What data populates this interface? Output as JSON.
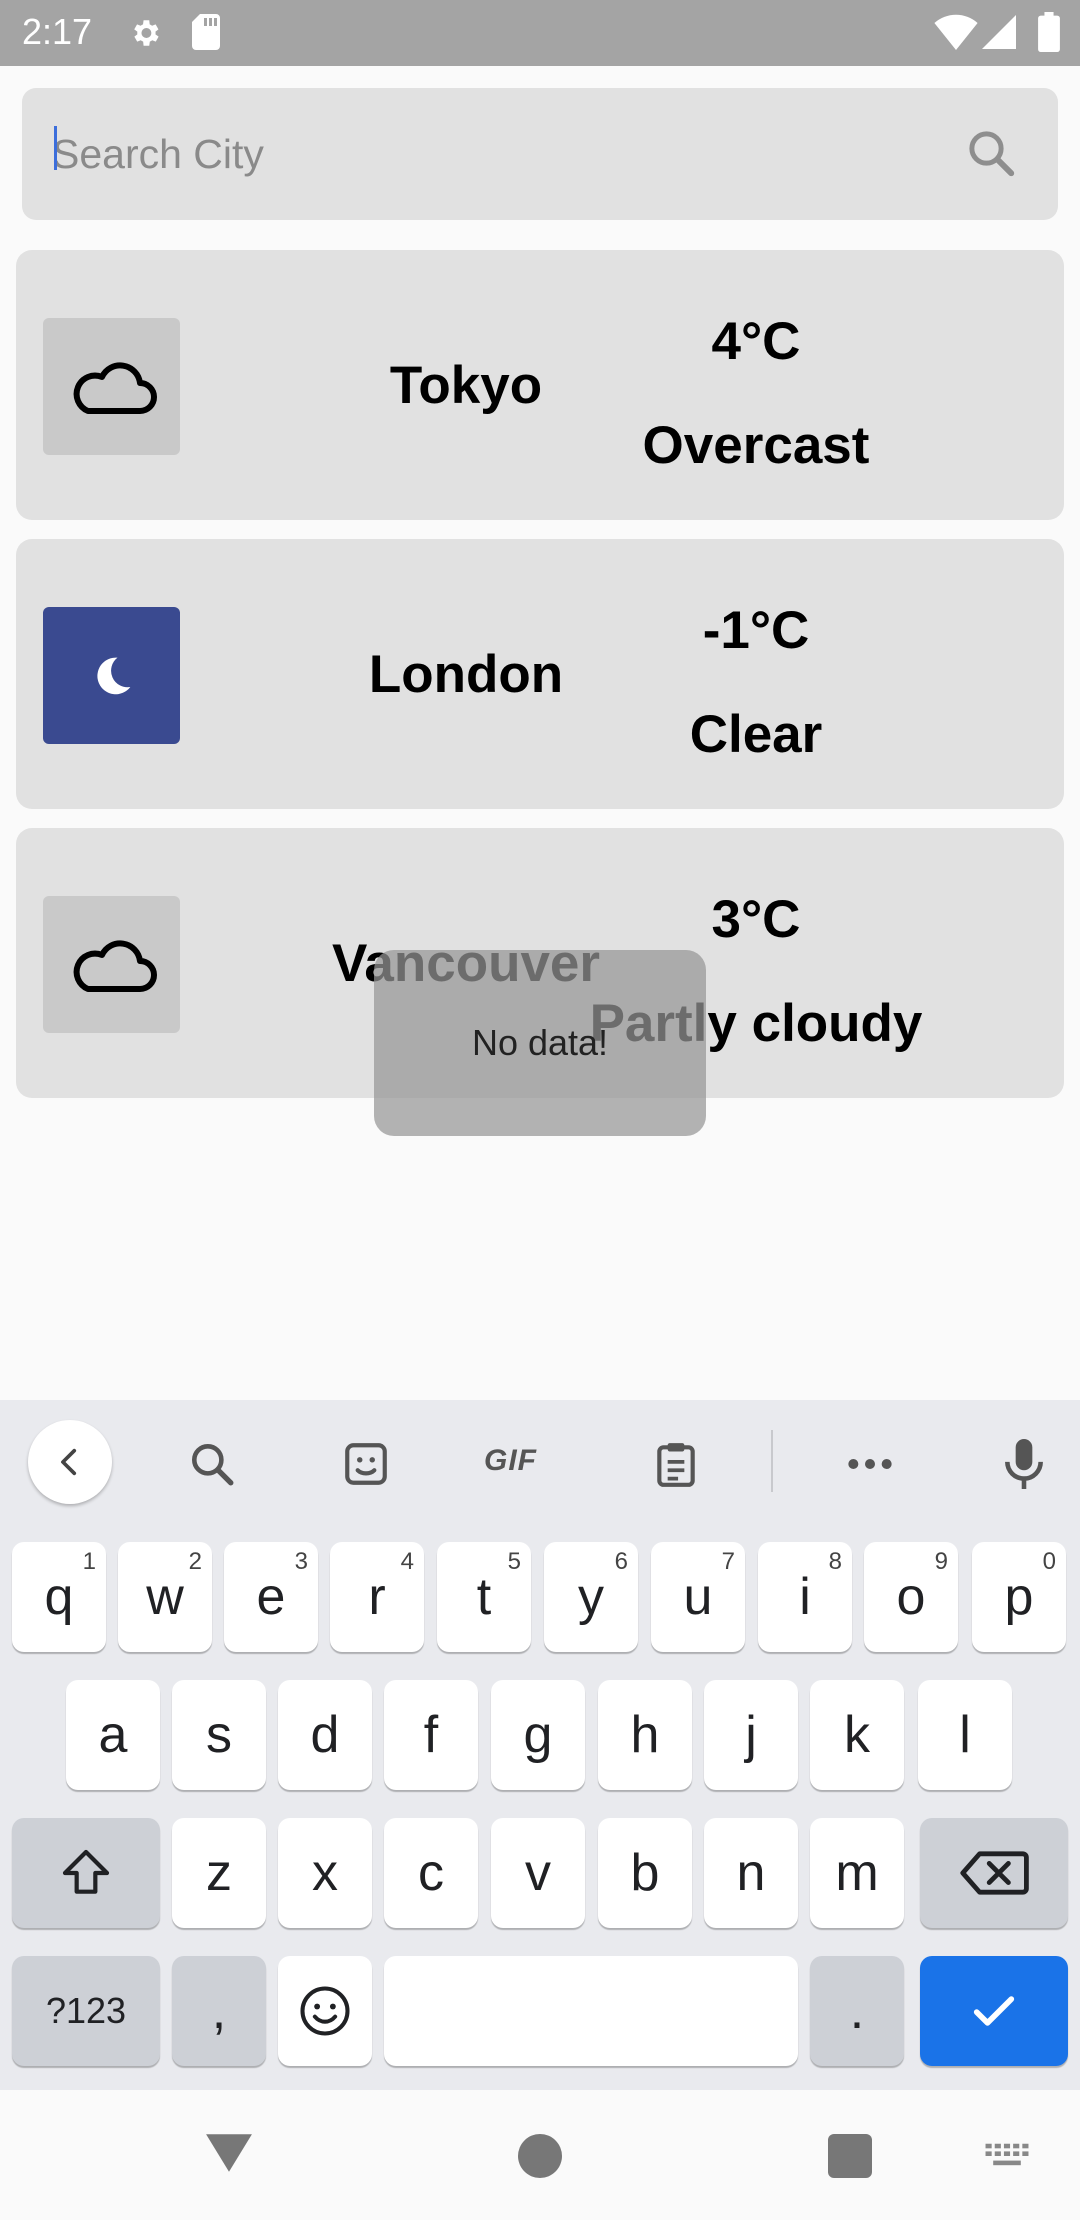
{
  "status": {
    "time": "2:17"
  },
  "search": {
    "placeholder": "Search City",
    "value": ""
  },
  "cities": [
    {
      "name": "Tokyo",
      "temp": "4°C",
      "condition": "Overcast",
      "icon": "cloud-icon"
    },
    {
      "name": "London",
      "temp": "-1°C",
      "condition": "Clear",
      "icon": "moon-icon"
    },
    {
      "name": "Vancouver",
      "temp": "3°C",
      "condition": "Partly cloudy",
      "icon": "cloud-icon"
    }
  ],
  "toast": {
    "message": "No data!"
  },
  "keyboard": {
    "toolbar": {
      "gif": "GIF"
    },
    "row1": [
      {
        "key": "q",
        "hint": "1"
      },
      {
        "key": "w",
        "hint": "2"
      },
      {
        "key": "e",
        "hint": "3"
      },
      {
        "key": "r",
        "hint": "4"
      },
      {
        "key": "t",
        "hint": "5"
      },
      {
        "key": "y",
        "hint": "6"
      },
      {
        "key": "u",
        "hint": "7"
      },
      {
        "key": "i",
        "hint": "8"
      },
      {
        "key": "o",
        "hint": "9"
      },
      {
        "key": "p",
        "hint": "0"
      }
    ],
    "row2": [
      "a",
      "s",
      "d",
      "f",
      "g",
      "h",
      "j",
      "k",
      "l"
    ],
    "row3": [
      "z",
      "x",
      "c",
      "v",
      "b",
      "n",
      "m"
    ],
    "row4": {
      "symbols": "?123",
      "comma": ",",
      "period": "."
    }
  },
  "colors": {
    "accent": "#1a73e8",
    "night_icon": "#3a4a90",
    "card_bg": "#e1e1e1"
  }
}
